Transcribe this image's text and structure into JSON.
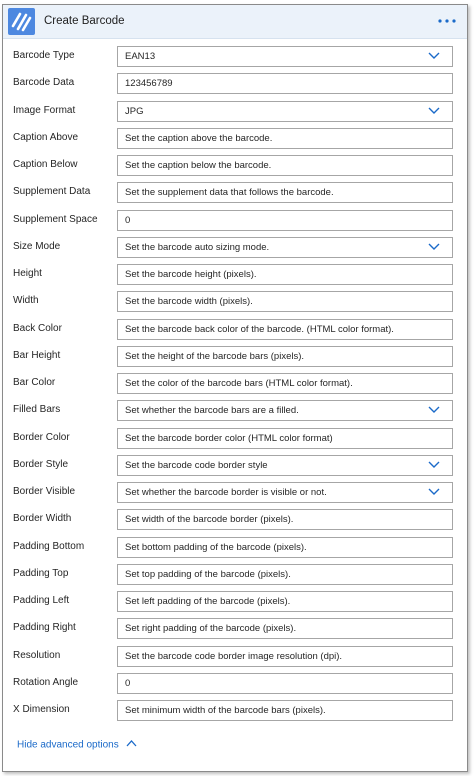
{
  "header": {
    "title": "Create Barcode",
    "logo_icon": "barcode-stripes-icon",
    "menu_icon": "ellipsis-icon"
  },
  "fields": [
    {
      "label": "Barcode Type",
      "value": "EAN13",
      "dropdown": true
    },
    {
      "label": "Barcode Data",
      "value": "123456789",
      "dropdown": false
    },
    {
      "label": "Image Format",
      "value": "JPG",
      "dropdown": true
    },
    {
      "label": "Caption Above",
      "value": "Set the caption above the barcode.",
      "dropdown": false
    },
    {
      "label": "Caption Below",
      "value": "Set the caption below the barcode.",
      "dropdown": false
    },
    {
      "label": "Supplement Data",
      "value": "Set the supplement data that follows the barcode.",
      "dropdown": false
    },
    {
      "label": "Supplement Space",
      "value": "0",
      "dropdown": false
    },
    {
      "label": "Size Mode",
      "value": "Set the barcode auto sizing mode.",
      "dropdown": true
    },
    {
      "label": "Height",
      "value": "Set the barcode height (pixels).",
      "dropdown": false
    },
    {
      "label": "Width",
      "value": "Set the barcode width (pixels).",
      "dropdown": false
    },
    {
      "label": "Back Color",
      "value": "Set the barcode back color of the barcode. (HTML color format).",
      "dropdown": false
    },
    {
      "label": "Bar Height",
      "value": "Set the height of the barcode bars (pixels).",
      "dropdown": false
    },
    {
      "label": "Bar Color",
      "value": "Set the color of the barcode bars (HTML color format).",
      "dropdown": false
    },
    {
      "label": "Filled Bars",
      "value": "Set whether the barcode bars are a filled.",
      "dropdown": true
    },
    {
      "label": "Border Color",
      "value": "Set the barcode border color (HTML color format)",
      "dropdown": false
    },
    {
      "label": "Border Style",
      "value": "Set the barcode code border style",
      "dropdown": true
    },
    {
      "label": "Border Visible",
      "value": "Set whether the barcode border is visible or not.",
      "dropdown": true
    },
    {
      "label": "Border Width",
      "value": "Set width of the barcode border (pixels).",
      "dropdown": false
    },
    {
      "label": "Padding Bottom",
      "value": "Set bottom padding of the barcode (pixels).",
      "dropdown": false
    },
    {
      "label": "Padding Top",
      "value": "Set top padding of the barcode (pixels).",
      "dropdown": false
    },
    {
      "label": "Padding Left",
      "value": "Set left padding of the barcode (pixels).",
      "dropdown": false
    },
    {
      "label": "Padding Right",
      "value": "Set right padding of the barcode (pixels).",
      "dropdown": false
    },
    {
      "label": "Resolution",
      "value": "Set the barcode code border image resolution (dpi).",
      "dropdown": false
    },
    {
      "label": "Rotation Angle",
      "value": "0",
      "dropdown": false
    },
    {
      "label": "X Dimension",
      "value": "Set minimum width of the barcode bars (pixels).",
      "dropdown": false
    }
  ],
  "footer": {
    "advanced_label": "Hide advanced options",
    "advanced_icon": "chevron-up-icon"
  },
  "colors": {
    "accent": "#1b6ac9",
    "header_bg": "#ebf2fa",
    "logo_bg": "#4d88e0"
  }
}
